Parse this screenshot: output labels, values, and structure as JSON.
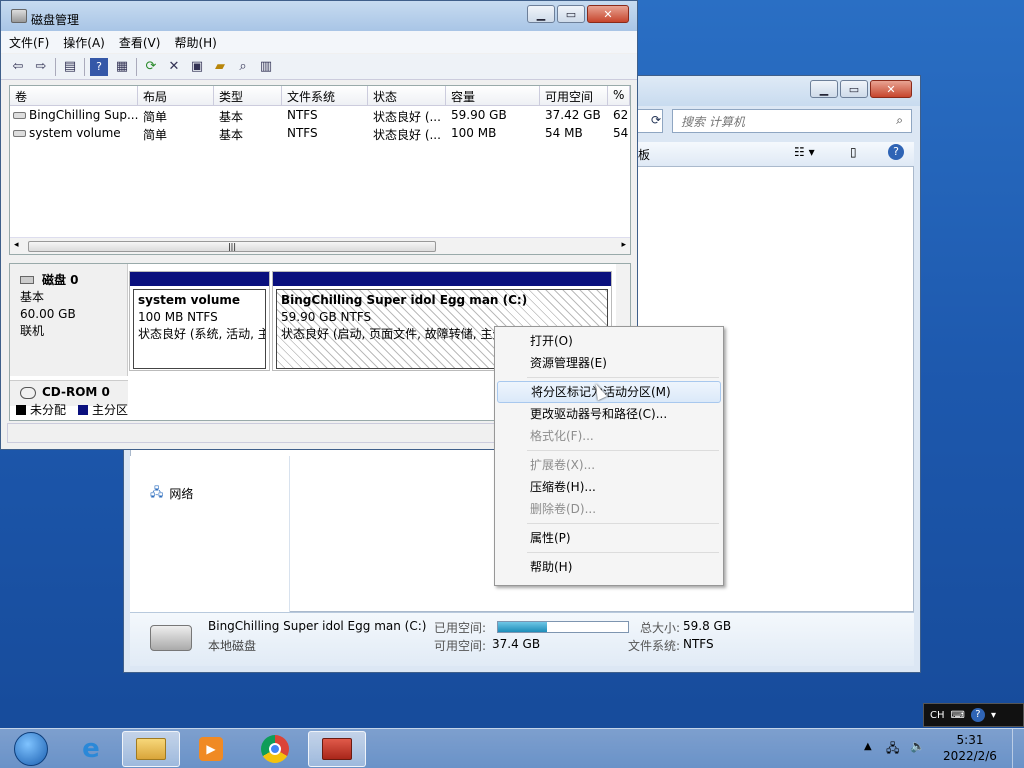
{
  "explorer": {
    "search_placeholder": "搜索 计算机",
    "toolbar_fragment": "板",
    "nav_network": "网络",
    "details": {
      "name": "BingChilling Super idol Egg man (C:)",
      "type": "本地磁盘",
      "used_label": "已用空间:",
      "free_label": "可用空间:",
      "free_value": "37.4 GB",
      "total_label": "总大小:",
      "total_value": "59.8 GB",
      "fs_label": "文件系统:",
      "fs_value": "NTFS",
      "used_fraction": 0.38
    }
  },
  "diskmgmt": {
    "title": "磁盘管理",
    "menu": [
      "文件(F)",
      "操作(A)",
      "查看(V)",
      "帮助(H)"
    ],
    "columns": [
      "卷",
      "布局",
      "类型",
      "文件系统",
      "状态",
      "容量",
      "可用空间",
      "%"
    ],
    "rows": [
      [
        "BingChilling Sup...",
        "简单",
        "基本",
        "NTFS",
        "状态良好 (...",
        "59.90 GB",
        "37.42 GB",
        "62"
      ],
      [
        "system volume",
        "简单",
        "基本",
        "NTFS",
        "状态良好 (...",
        "100 MB",
        "54 MB",
        "54"
      ]
    ],
    "disk0": {
      "name": "磁盘 0",
      "type": "基本",
      "size": "60.00 GB",
      "status": "联机"
    },
    "partitions": [
      {
        "name": "system volume",
        "size": "100 MB NTFS",
        "status": "状态良好 (系统, 活动, 主"
      },
      {
        "name": "BingChilling Super idol Egg man  (C:)",
        "size": "59.90 GB NTFS",
        "status": "状态良好 (启动, 页面文件, 故障转储, 主分"
      }
    ],
    "cdrom": "CD-ROM 0",
    "legend": [
      {
        "label": "未分配",
        "color": "#000000"
      },
      {
        "label": "主分区",
        "color": "#0a107e"
      }
    ]
  },
  "context_menu": [
    {
      "label": "打开(O)",
      "disabled": false
    },
    {
      "label": "资源管理器(E)",
      "disabled": false
    },
    {
      "sep": true
    },
    {
      "label": "将分区标记为活动分区(M)",
      "disabled": false,
      "highlight": true
    },
    {
      "label": "更改驱动器号和路径(C)...",
      "disabled": false
    },
    {
      "label": "格式化(F)...",
      "disabled": true
    },
    {
      "sep": true
    },
    {
      "label": "扩展卷(X)...",
      "disabled": true
    },
    {
      "label": "压缩卷(H)...",
      "disabled": false
    },
    {
      "label": "删除卷(D)...",
      "disabled": true
    },
    {
      "sep": true
    },
    {
      "label": "属性(P)",
      "disabled": false
    },
    {
      "sep": true
    },
    {
      "label": "帮助(H)",
      "disabled": false
    }
  ],
  "langbar": {
    "lang": "CH"
  },
  "clock": {
    "time": "5:31",
    "date": "2022/2/6"
  }
}
